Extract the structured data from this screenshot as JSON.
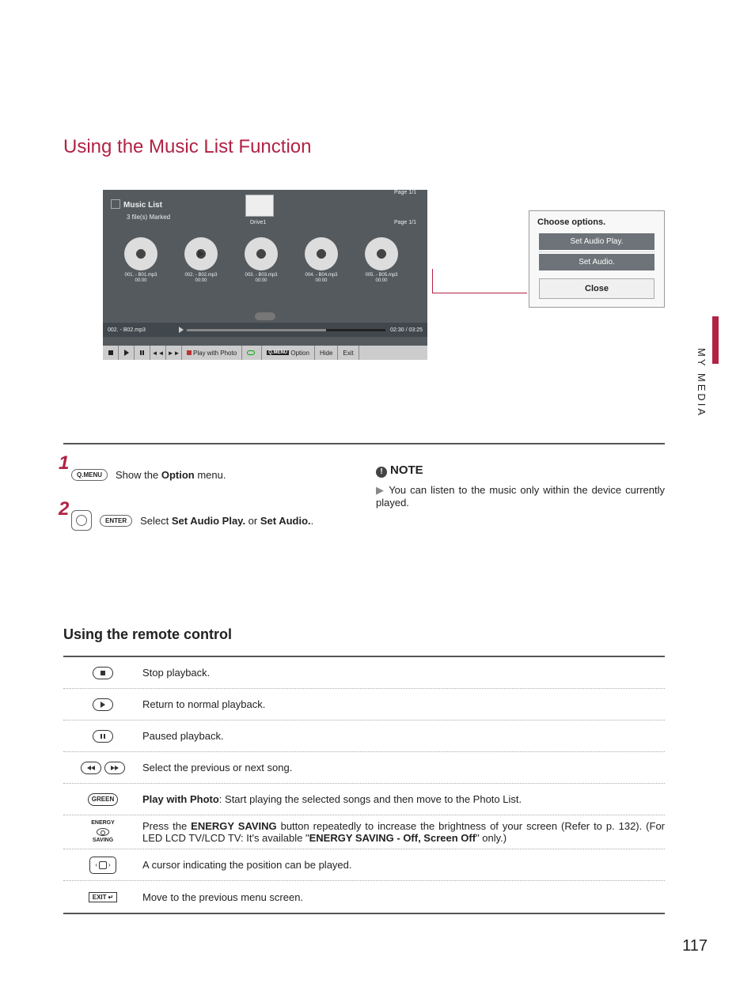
{
  "heading": "Using the Music List Function",
  "player": {
    "title": "Music List",
    "marked": "3 file(s) Marked",
    "drive": "Drive1",
    "page_top": "Page 1/1",
    "page_inner": "Page 1/1",
    "thumbs": [
      {
        "name": "001. - B01.mp3",
        "dur": "00:00"
      },
      {
        "name": "002. - B02.mp3",
        "dur": "00:00"
      },
      {
        "name": "003. - B03.mp3",
        "dur": "00:00"
      },
      {
        "name": "004. - B04.mp3",
        "dur": "00:00"
      },
      {
        "name": "005. - B05.mp3",
        "dur": "00:00"
      }
    ],
    "now_title": "002. - B02.mp3",
    "now_time": "02:30 / 03:25",
    "controls": {
      "play_with_photo": "Play with Photo",
      "qmenu": "Q.MENU",
      "option": "Option",
      "hide": "Hide",
      "exit": "Exit"
    }
  },
  "options_box": {
    "title": "Choose options.",
    "set_audio_play": "Set Audio Play.",
    "set_audio": "Set Audio.",
    "close": "Close"
  },
  "steps": {
    "one_btn": "Q.MENU",
    "one_text_pre": "Show the ",
    "one_bold": "Option",
    "one_text_post": " menu.",
    "two_btn": "ENTER",
    "two_text_pre": "Select ",
    "two_bold1": "Set Audio Play.",
    "two_mid": " or ",
    "two_bold2": "Set Audio.",
    "two_post": "."
  },
  "note": {
    "label": "NOTE",
    "body": "You can listen to the music only within the device currently played."
  },
  "remote_heading": "Using the remote control",
  "rc": [
    {
      "desc": "Stop playback."
    },
    {
      "desc": "Return to normal playback."
    },
    {
      "desc": "Paused playback."
    },
    {
      "desc": "Select the previous or next song."
    },
    {
      "desc_pre": "",
      "bold": "Play with Photo",
      "desc_post": ": Start playing the selected songs and then move to the Photo List.",
      "green": "GREEN"
    },
    {
      "desc_pre": "Press the ",
      "bold": "ENERGY SAVING",
      "desc_mid": " button repeatedly to increase the brightness of your screen (Refer to p. 132). (For LED LCD TV/LCD TV: It's available \"",
      "bold2": "ENERGY SAVING - Off, Screen Off",
      "desc_post": "\" only.)",
      "energy_top": "ENERGY",
      "energy_bot": "SAVING"
    },
    {
      "desc": "A cursor indicating the position can be played."
    },
    {
      "desc": "Move to the previous menu screen.",
      "exit": "EXIT"
    }
  ],
  "side": "MY MEDIA",
  "page_number": "117"
}
